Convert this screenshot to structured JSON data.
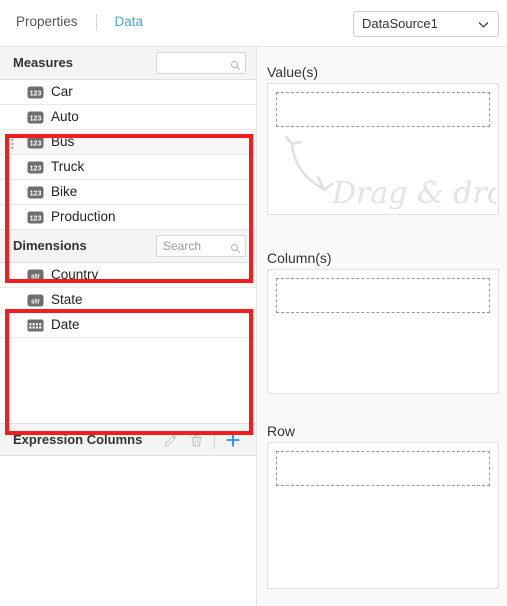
{
  "header": {
    "tabs": [
      {
        "label": "Properties",
        "active": false
      },
      {
        "label": "Data",
        "active": true
      }
    ],
    "datasource": {
      "value": "DataSource1",
      "icon": "chevron-down-icon"
    }
  },
  "measures": {
    "title": "Measures",
    "search": {
      "value": "",
      "placeholder": ""
    },
    "items": [
      {
        "label": "Car",
        "type_icon": "number-type-icon",
        "type_text": "123",
        "hovered": false
      },
      {
        "label": "Auto",
        "type_icon": "number-type-icon",
        "type_text": "123",
        "hovered": false
      },
      {
        "label": "Bus",
        "type_icon": "number-type-icon",
        "type_text": "123",
        "hovered": true
      },
      {
        "label": "Truck",
        "type_icon": "number-type-icon",
        "type_text": "123",
        "hovered": false
      },
      {
        "label": "Bike",
        "type_icon": "number-type-icon",
        "type_text": "123",
        "hovered": false
      },
      {
        "label": "Production",
        "type_icon": "number-type-icon",
        "type_text": "123",
        "hovered": false
      }
    ]
  },
  "dimensions": {
    "title": "Dimensions",
    "search": {
      "value": "",
      "placeholder": "Search"
    },
    "items": [
      {
        "label": "Country",
        "type_icon": "string-type-icon",
        "type_text": "str"
      },
      {
        "label": "State",
        "type_icon": "string-type-icon",
        "type_text": "str"
      },
      {
        "label": "Date",
        "type_icon": "calendar-type-icon",
        "type_text": ""
      }
    ]
  },
  "expression_columns": {
    "title": "Expression Columns",
    "tools": [
      {
        "name": "edit-icon",
        "label": "Edit",
        "enabled": false
      },
      {
        "name": "delete-icon",
        "label": "Delete",
        "enabled": false
      },
      {
        "name": "add-icon",
        "label": "Add",
        "enabled": true
      }
    ]
  },
  "shelves": [
    {
      "label": "Value(s)",
      "hint": "Drag & drop",
      "show_hint": true
    },
    {
      "label": "Column(s)",
      "hint": "",
      "show_hint": false
    },
    {
      "label": "Row",
      "hint": "",
      "show_hint": false
    }
  ],
  "annotations": [
    {
      "name": "measures-list-highlight",
      "color": "#f21d1d"
    },
    {
      "name": "dimensions-list-highlight",
      "color": "#f21d1d"
    }
  ],
  "colors": {
    "accent": "#4ba6de",
    "highlight": "#f21d1d",
    "panel_bg": "#f4f4f4",
    "text": "#333333"
  }
}
